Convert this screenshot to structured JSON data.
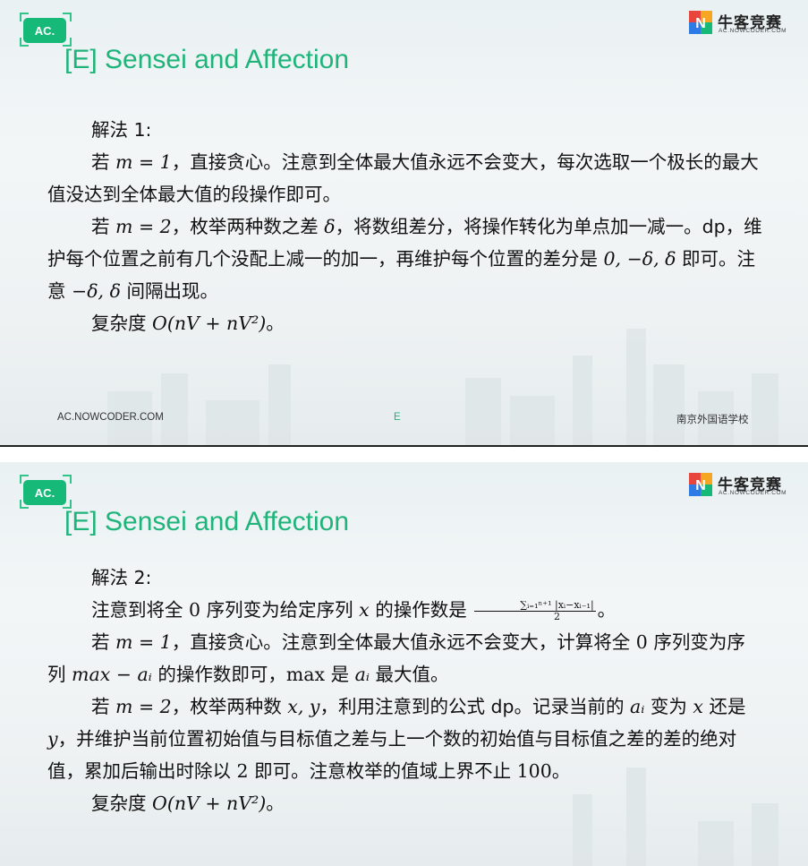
{
  "slides": [
    {
      "badge": "AC.",
      "title": "[E] Sensei and Affection",
      "logo": {
        "name": "牛客竞赛",
        "sub": "AC.NOWCODER.COM"
      },
      "heading": "解法 1:",
      "m1_lead": "若 ",
      "m1_math": "m = 1",
      "m1_text": "，直接贪心。注意到全体最大值永远不会变大，每次选取一个极长的最大值没达到全体最大值的段操作即可。",
      "m2_lead": "若 ",
      "m2_math": "m = 2",
      "m2_text1": "，枚举两种数之差 ",
      "m2_delta": "δ",
      "m2_text2": "，将数组差分，将操作转化为单点加一减一。dp，维护每个位置之前有几个没配上减一的加一，再维护每个位置的差分是 ",
      "m2_vals": "0, −δ, δ",
      "m2_text3": " 即可。注意 ",
      "m2_vals2": "−δ, δ",
      "m2_text4": " 间隔出现。",
      "cx_label": "复杂度 ",
      "cx_math": "O(nV + nV²)",
      "cx_end": "。",
      "footer": {
        "left": "AC.NOWCODER.COM",
        "center": "E",
        "right": "南京外国语学校"
      }
    },
    {
      "badge": "AC.",
      "title": "[E] Sensei and Affection",
      "logo": {
        "name": "牛客竞赛",
        "sub": "AC.NOWCODER.COM"
      },
      "heading": "解法 2:",
      "n_t1": "注意到将全 ",
      "n_zero": "0",
      "n_t2": " 序列变为给定序列 ",
      "n_x": "x",
      "n_t3": " 的操作数是 ",
      "n_frac_num": "∑ᵢ₌₁ⁿ⁺¹ |xᵢ−xᵢ₋₁|",
      "n_frac_den": "2",
      "n_t4": "。",
      "m1_lead": "若 ",
      "m1_math": "m = 1",
      "m1_t1": "，直接贪心。注意到全体最大值永远不会变大，计算将全 ",
      "m1_zero": "0",
      "m1_t2": " 序列变为序列 ",
      "m1_expr": "max − aᵢ",
      "m1_t3": " 的操作数即可，",
      "m1_max": "max",
      "m1_t4": " 是 ",
      "m1_ai": "aᵢ",
      "m1_t5": " 最大值。",
      "m2_lead": "若 ",
      "m2_math": "m = 2",
      "m2_t1": "，枚举两种数 ",
      "m2_xy": "x, y",
      "m2_t2": "，利用注意到的公式 dp。记录当前的 ",
      "m2_ai": "aᵢ",
      "m2_t3": " 变为 ",
      "m2_x": "x",
      "m2_t4": " 还是 ",
      "m2_y": "y",
      "m2_t5": "，并维护当前位置初始值与目标值之差与上一个数的初始值与目标值之差的差的绝对值，累加后输出时除以 ",
      "m2_two": "2",
      "m2_t6": " 即可。注意枚举的值域上界不止 ",
      "m2_hundred": "100",
      "m2_t7": "。",
      "cx_label": "复杂度 ",
      "cx_math": "O(nV + nV²)",
      "cx_end": "。"
    }
  ],
  "colors": {
    "accent": "#1fb47a",
    "badge": "#17b978",
    "text": "#111111"
  }
}
